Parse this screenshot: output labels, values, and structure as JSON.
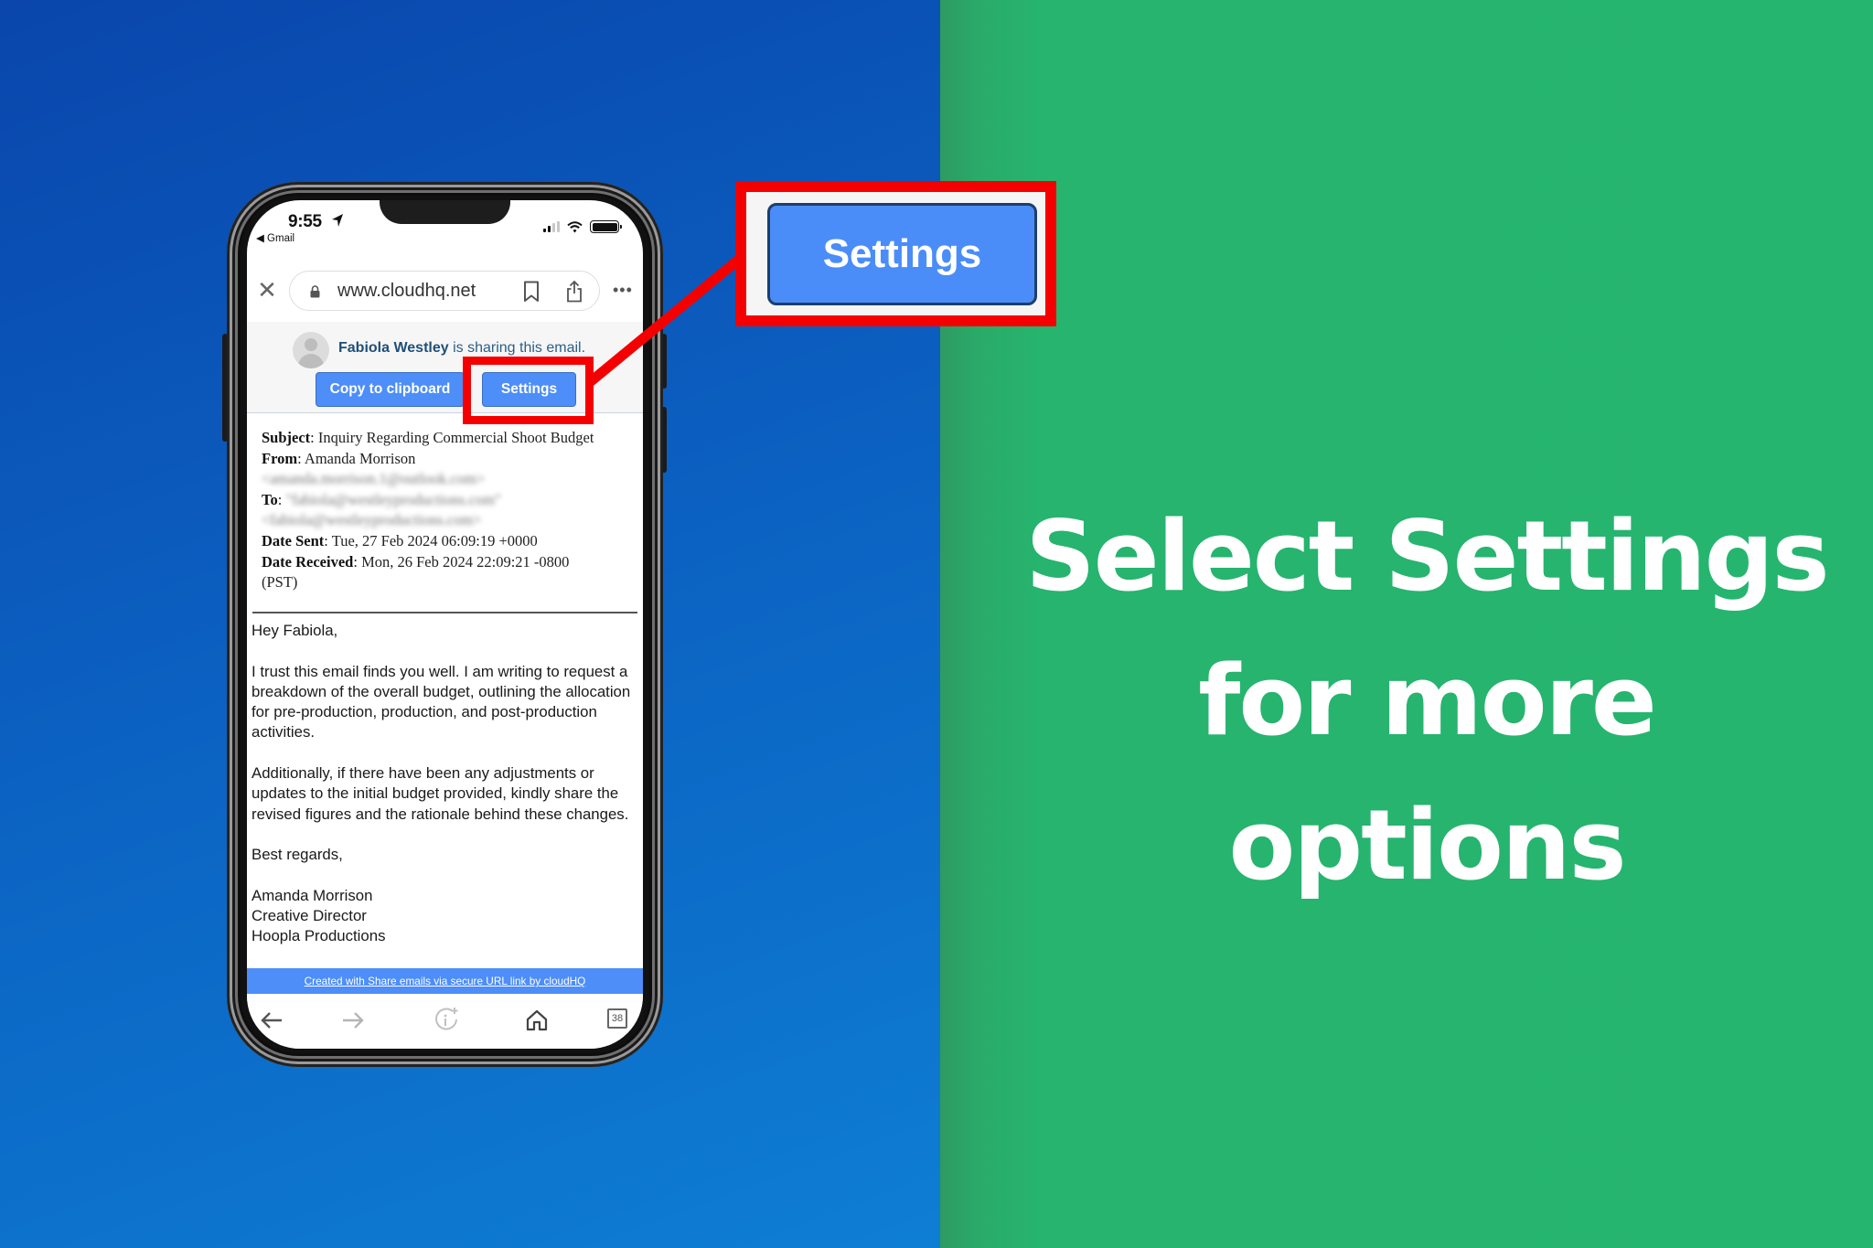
{
  "background": {
    "left_color": "#0B5FC0",
    "right_color": "#26B56F",
    "accent_red": "#F40000"
  },
  "phone": {
    "status_bar": {
      "time": "9:55",
      "back_app": "◀ Gmail",
      "location_icon": "location-arrow-icon",
      "signal_icon": "cellular-signal-icon",
      "wifi_icon": "wifi-icon",
      "battery_icon": "battery-full-icon"
    },
    "browser": {
      "close_icon": "close-icon",
      "lock_icon": "lock-icon",
      "url": "www.cloudhq.net",
      "bookmark_icon": "bookmark-icon",
      "share_icon": "share-icon",
      "more_label": "•••"
    },
    "share_bar": {
      "sharer_name": "Fabiola Westley",
      "sharing_text": " is sharing this email.",
      "copy_button": "Copy to clipboard",
      "settings_button": "Settings"
    },
    "email_header": {
      "subject_label": "Subject",
      "subject": "Inquiry Regarding Commercial Shoot Budget",
      "from_label": "From",
      "from_name": "Amanda Morrison",
      "from_email_blurred": "<amanda.morrison.1@outlook.com>",
      "to_label": "To",
      "to_name_blurred": "\"fabiola@westleyproductions.com\"",
      "to_email_blurred": "<fabiola@westleyproductions.com>",
      "date_sent_label": "Date Sent",
      "date_sent": "Tue, 27 Feb 2024 06:09:19 +0000",
      "date_received_label": "Date Received",
      "date_received": "Mon, 26 Feb 2024 22:09:21 -0800",
      "date_received_tz": "(PST)"
    },
    "email_body": {
      "greeting": "Hey Fabiola,",
      "paragraph1": "I trust this email finds you well. I am writing to request a breakdown of the overall budget, outlining the allocation for pre-production, production, and post-production activities.",
      "paragraph2": "Additionally, if there have been any adjustments or updates to the initial budget provided, kindly share the revised figures and the rationale behind these changes.",
      "closing": "Best regards,",
      "signature_name": "Amanda Morrison",
      "signature_title": "Creative Director",
      "signature_company": "Hoopla Productions"
    },
    "footer_banner": "Created with Share emails via secure URL link by cloudHQ",
    "toolbar": {
      "back_icon": "arrow-left-icon",
      "forward_icon": "arrow-right-icon",
      "info_icon": "info-plus-icon",
      "home_icon": "home-icon",
      "tabs_count": "38"
    }
  },
  "callout": {
    "button_label": "Settings"
  },
  "headline": {
    "line1": "Select Settings",
    "line2": "for more options"
  }
}
